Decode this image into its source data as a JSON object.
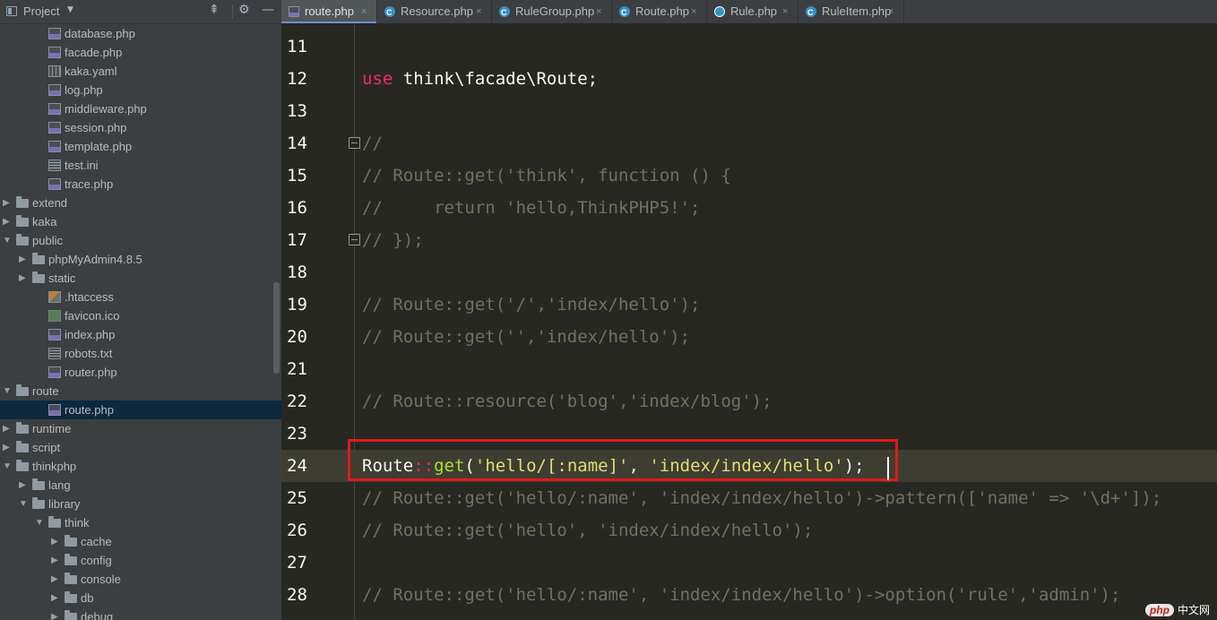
{
  "project_panel": {
    "title": "Project",
    "tree": [
      {
        "label": "database.php",
        "type": "php",
        "depth": 3,
        "arrow": ""
      },
      {
        "label": "facade.php",
        "type": "php",
        "depth": 3,
        "arrow": ""
      },
      {
        "label": "kaka.yaml",
        "type": "yaml",
        "depth": 3,
        "arrow": ""
      },
      {
        "label": "log.php",
        "type": "php",
        "depth": 3,
        "arrow": ""
      },
      {
        "label": "middleware.php",
        "type": "php",
        "depth": 3,
        "arrow": ""
      },
      {
        "label": "session.php",
        "type": "php",
        "depth": 3,
        "arrow": ""
      },
      {
        "label": "template.php",
        "type": "php",
        "depth": 3,
        "arrow": ""
      },
      {
        "label": "test.ini",
        "type": "ini",
        "depth": 3,
        "arrow": ""
      },
      {
        "label": "trace.php",
        "type": "php",
        "depth": 3,
        "arrow": ""
      },
      {
        "label": "extend",
        "type": "folder",
        "depth": 1,
        "arrow": "collapsed"
      },
      {
        "label": "kaka",
        "type": "folder",
        "depth": 1,
        "arrow": "collapsed"
      },
      {
        "label": "public",
        "type": "folder",
        "depth": 1,
        "arrow": "expanded"
      },
      {
        "label": "phpMyAdmin4.8.5",
        "type": "folder",
        "depth": 2,
        "arrow": "collapsed"
      },
      {
        "label": "static",
        "type": "folder",
        "depth": 2,
        "arrow": "collapsed"
      },
      {
        "label": ".htaccess",
        "type": "htaccess",
        "depth": 3,
        "arrow": ""
      },
      {
        "label": "favicon.ico",
        "type": "ico",
        "depth": 3,
        "arrow": ""
      },
      {
        "label": "index.php",
        "type": "php",
        "depth": 3,
        "arrow": ""
      },
      {
        "label": "robots.txt",
        "type": "txt",
        "depth": 3,
        "arrow": ""
      },
      {
        "label": "router.php",
        "type": "php",
        "depth": 3,
        "arrow": ""
      },
      {
        "label": "route",
        "type": "folder",
        "depth": 1,
        "arrow": "expanded"
      },
      {
        "label": "route.php",
        "type": "php",
        "depth": 3,
        "arrow": "",
        "selected": true
      },
      {
        "label": "runtime",
        "type": "folder",
        "depth": 1,
        "arrow": "collapsed"
      },
      {
        "label": "script",
        "type": "folder",
        "depth": 1,
        "arrow": "collapsed"
      },
      {
        "label": "thinkphp",
        "type": "folder",
        "depth": 1,
        "arrow": "expanded"
      },
      {
        "label": "lang",
        "type": "folder",
        "depth": 2,
        "arrow": "collapsed"
      },
      {
        "label": "library",
        "type": "folder",
        "depth": 2,
        "arrow": "expanded"
      },
      {
        "label": "think",
        "type": "folder",
        "depth": 3,
        "arrow": "expanded"
      },
      {
        "label": "cache",
        "type": "folder",
        "depth": 4,
        "arrow": "collapsed"
      },
      {
        "label": "config",
        "type": "folder",
        "depth": 4,
        "arrow": "collapsed"
      },
      {
        "label": "console",
        "type": "folder",
        "depth": 4,
        "arrow": "collapsed"
      },
      {
        "label": "db",
        "type": "folder",
        "depth": 4,
        "arrow": "collapsed"
      },
      {
        "label": "debug",
        "type": "folder",
        "depth": 4,
        "arrow": "collapsed"
      }
    ]
  },
  "tabs": [
    {
      "label": "route.php",
      "icon": "php-file-icon",
      "active": true
    },
    {
      "label": "Resource.php",
      "icon": "class-icon",
      "active": false
    },
    {
      "label": "RuleGroup.php",
      "icon": "class-icon",
      "active": false
    },
    {
      "label": "Route.php",
      "icon": "class-icon",
      "active": false
    },
    {
      "label": "Rule.php",
      "icon": "abstract-class-icon",
      "active": false
    },
    {
      "label": "RuleItem.php",
      "icon": "class-icon",
      "active": false
    }
  ],
  "tab_close_glyph": "×",
  "editor": {
    "current_line": 24,
    "lines": [
      {
        "n": "11",
        "tokens": []
      },
      {
        "n": "12",
        "tokens": [
          {
            "c": "kw",
            "t": "use"
          },
          {
            "c": "pl",
            "t": " think\\facade\\Route;"
          }
        ]
      },
      {
        "n": "13",
        "tokens": []
      },
      {
        "n": "14",
        "fold": true,
        "tokens": [
          {
            "c": "cm",
            "t": "//"
          }
        ]
      },
      {
        "n": "15",
        "tokens": [
          {
            "c": "cm",
            "t": "// Route::get('think', function () {"
          }
        ]
      },
      {
        "n": "16",
        "tokens": [
          {
            "c": "cm",
            "t": "//     return 'hello,ThinkPHP5!';"
          }
        ]
      },
      {
        "n": "17",
        "fold": true,
        "tokens": [
          {
            "c": "cm",
            "t": "// });"
          }
        ]
      },
      {
        "n": "18",
        "tokens": []
      },
      {
        "n": "19",
        "tokens": [
          {
            "c": "cm",
            "t": "// Route::get('/','index/hello');"
          }
        ]
      },
      {
        "n": "20",
        "tokens": [
          {
            "c": "cm",
            "t": "// Route::get('','index/hello');"
          }
        ]
      },
      {
        "n": "21",
        "tokens": []
      },
      {
        "n": "22",
        "tokens": [
          {
            "c": "cm",
            "t": "// Route::resource('blog','index/blog');"
          }
        ]
      },
      {
        "n": "23",
        "tokens": []
      },
      {
        "n": "24",
        "tokens": [
          {
            "c": "pl",
            "t": "Route"
          },
          {
            "c": "op",
            "t": "::"
          },
          {
            "c": "fn",
            "t": "get"
          },
          {
            "c": "pl",
            "t": "("
          },
          {
            "c": "st",
            "t": "'hello/[:name]'"
          },
          {
            "c": "pl",
            "t": ", "
          },
          {
            "c": "st",
            "t": "'index/index/hello'"
          },
          {
            "c": "pl",
            "t": ");"
          }
        ]
      },
      {
        "n": "25",
        "tokens": [
          {
            "c": "cm",
            "t": "// Route::get('hello/:name', 'index/index/hello')->pattern(['name' => '\\d+']);"
          }
        ]
      },
      {
        "n": "26",
        "tokens": [
          {
            "c": "cm",
            "t": "// Route::get('hello', 'index/index/hello');"
          }
        ]
      },
      {
        "n": "27",
        "tokens": []
      },
      {
        "n": "28",
        "tokens": [
          {
            "c": "cm",
            "t": "// Route::get('hello/:name', 'index/index/hello')->option('rule','admin');"
          }
        ]
      }
    ]
  },
  "watermark": {
    "logo": "php",
    "text": "中文网"
  }
}
